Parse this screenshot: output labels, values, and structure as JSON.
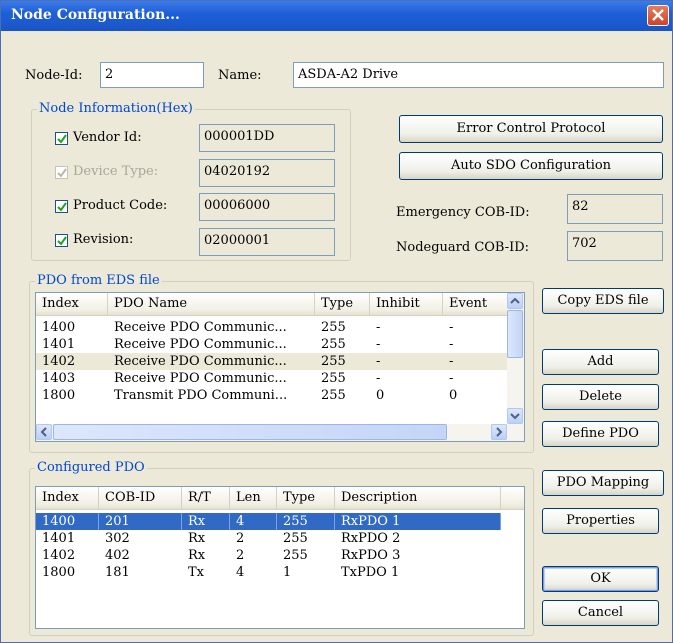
{
  "window": {
    "title": "Node Configuration..."
  },
  "node": {
    "id_label": "Node-Id:",
    "id_value": "2",
    "name_label": "Name:",
    "name_value": "ASDA-A2 Drive"
  },
  "node_info": {
    "title": "Node Information(Hex)",
    "vendor_id": {
      "label": "Vendor Id:",
      "value": "000001DD",
      "checked": true
    },
    "device_type": {
      "label": "Device Type:",
      "value": "04020192",
      "checked": true,
      "disabled": true
    },
    "product_code": {
      "label": "Product Code:",
      "value": "00006000",
      "checked": true
    },
    "revision": {
      "label": "Revision:",
      "value": "02000001",
      "checked": true
    }
  },
  "right_panel": {
    "error_control_button": "Error Control Protocol",
    "auto_sdo_button": "Auto SDO Configuration",
    "emergency_label": "Emergency COB-ID:",
    "emergency_value": "82",
    "nodeguard_label": "Nodeguard COB-ID:",
    "nodeguard_value": "702"
  },
  "eds": {
    "title": "PDO from EDS file",
    "columns": [
      "Index",
      "PDO Name",
      "Type",
      "Inhibit",
      "Event"
    ],
    "rows": [
      [
        "1400",
        "Receive PDO Communic...",
        "255",
        "-",
        "-"
      ],
      [
        "1401",
        "Receive PDO Communic...",
        "255",
        "-",
        "-"
      ],
      [
        "1402",
        "Receive PDO Communic...",
        "255",
        "-",
        "-"
      ],
      [
        "1403",
        "Receive PDO Communic...",
        "255",
        "-",
        "-"
      ],
      [
        "1800",
        "Transmit PDO Communi...",
        "255",
        "0",
        "0"
      ]
    ],
    "copy_button": "Copy EDS file",
    "add_button": "Add",
    "delete_button": "Delete",
    "define_button": "Define PDO"
  },
  "configured": {
    "title": "Configured PDO",
    "columns": [
      "Index",
      "COB-ID",
      "R/T",
      "Len",
      "Type",
      "Description"
    ],
    "rows": [
      [
        "1400",
        "201",
        "Rx",
        "4",
        "255",
        "RxPDO 1"
      ],
      [
        "1401",
        "302",
        "Rx",
        "2",
        "255",
        "RxPDO 2"
      ],
      [
        "1402",
        "402",
        "Rx",
        "2",
        "255",
        "RxPDO 3"
      ],
      [
        "1800",
        "181",
        "Tx",
        "4",
        "1",
        "TxPDO 1"
      ]
    ],
    "mapping_button": "PDO Mapping",
    "properties_button": "Properties"
  },
  "dialog_buttons": {
    "ok": "OK",
    "cancel": "Cancel"
  },
  "colors": {
    "title_bar": "#1f5fd6",
    "selection": "#316ac5",
    "group_title": "#0046d5"
  }
}
